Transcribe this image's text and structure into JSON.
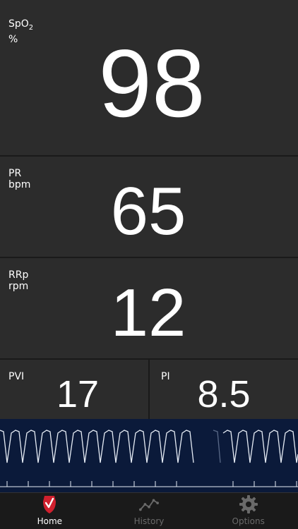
{
  "spo2": {
    "label": "SpO",
    "sub": "2",
    "unit": "%",
    "value": "98"
  },
  "pr": {
    "label": "PR",
    "unit": "bpm",
    "value": "65"
  },
  "rrp": {
    "label": "RRp",
    "unit": "rpm",
    "value": "12"
  },
  "pvi": {
    "label": "PVI",
    "value": "17"
  },
  "pi": {
    "label": "PI",
    "value": "8.5"
  },
  "tabs": [
    {
      "label": "Home",
      "icon": "masimo-logo-icon",
      "active": true
    },
    {
      "label": "History",
      "icon": "chart-line-icon",
      "active": false
    },
    {
      "label": "Options",
      "icon": "gear-icon",
      "active": false
    }
  ],
  "colors": {
    "panel": "#2c2c2c",
    "wave_bg": "#0b1a3a",
    "wave_line": "#e6ecf5",
    "accent": "#d0202e",
    "inactive_tab": "#6a6a6a"
  }
}
